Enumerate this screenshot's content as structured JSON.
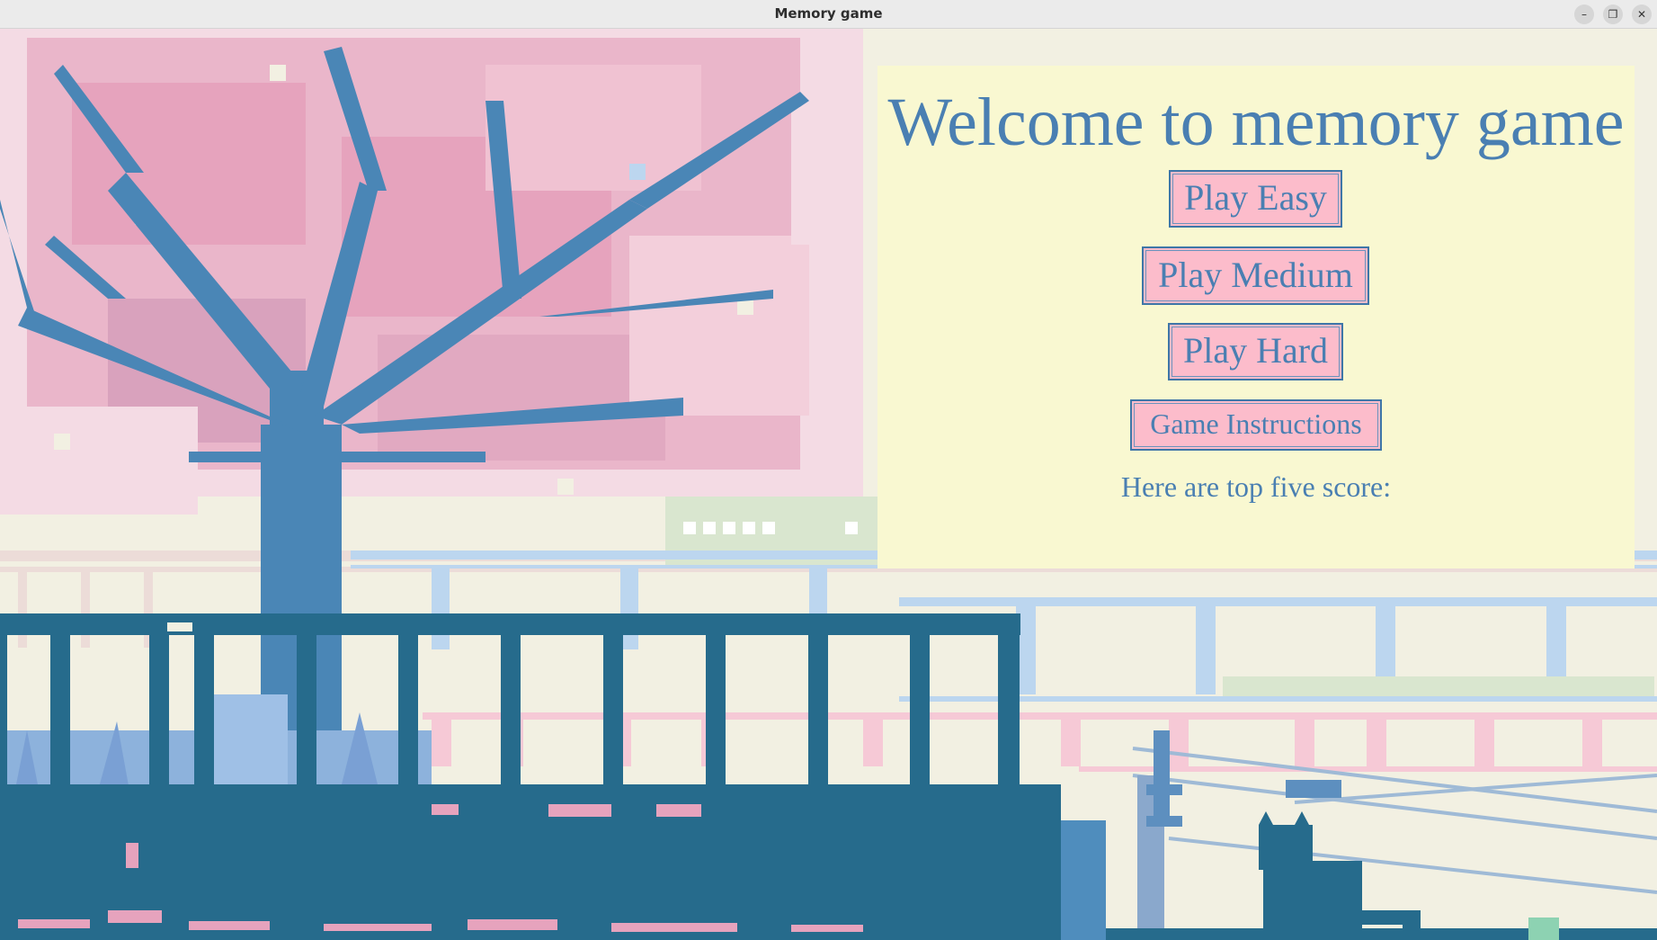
{
  "window": {
    "title": "Memory game"
  },
  "window_controls": {
    "minimize": "–",
    "maximize": "❐",
    "close": "✕"
  },
  "menu": {
    "heading": "Welcome to memory game",
    "buttons": {
      "easy": "Play Easy",
      "medium": "Play Medium",
      "hard": "Play Hard",
      "instructions": "Game Instructions"
    },
    "scores_label": "Here are top five score:"
  },
  "colors": {
    "panel_bg": "#f9f8d1",
    "text_blue": "#4a7fb2",
    "button_pink": "#fcbccb",
    "blossom_pink": "#e7a6c0",
    "trunk_blue": "#4a86b6",
    "train_teal": "#266b8c",
    "sky_cream": "#f2f0e2"
  }
}
